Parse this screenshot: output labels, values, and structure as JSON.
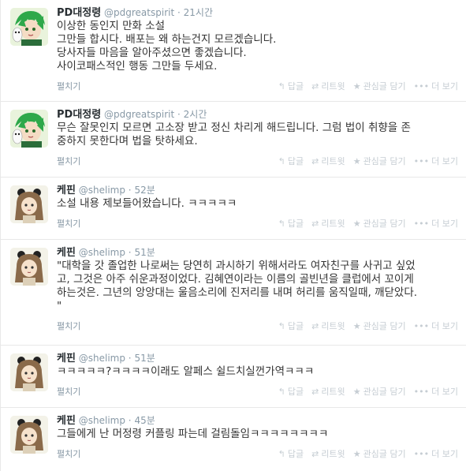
{
  "actions": {
    "reply": "답글",
    "retweet": "리트윗",
    "favorite": "관심글 담기",
    "more": "더 보기"
  },
  "expand_label": "펼치기",
  "icons": {
    "reply": "reply-icon",
    "retweet": "retweet-icon",
    "favorite": "star-icon",
    "more": "ellipsis-icon"
  },
  "tweets": [
    {
      "name": "PD대정령",
      "handle": "@pdgreatspirit",
      "dot": "·",
      "time": "21시간",
      "lines": [
        "이상한 동인지 만화 소설",
        "그만들 합시다. 배포는 왜 하는건지 모르겠습니다.",
        "당사자들 마음을 알아주셨으면 좋겠습니다.",
        "사이코패스적인 행동 그만들 두세요."
      ]
    },
    {
      "name": "PD대정령",
      "handle": "@pdgreatspirit",
      "dot": "·",
      "time": "2시간",
      "lines": [
        "무슨 잘못인지 모르면 고소장 받고 정신 차리게 해드립니다. 그럼 법이 취향을 존",
        "중하지 못한다며 법을 탓하세요."
      ]
    },
    {
      "name": "케핀",
      "handle": "@shelimp",
      "dot": "·",
      "time": "52분",
      "lines": [
        "소설 내용 제보들어왔습니다. ㅋㅋㅋㅋㅋ"
      ]
    },
    {
      "name": "케핀",
      "handle": "@shelimp",
      "dot": "·",
      "time": "51분",
      "lines": [
        "\"대학을 갓 졸업한 나로써는 당연히 과시하기 위해서라도 여자친구를 사귀고 싶었",
        "고, 그것은 아주 쉬운과정이었다. 김혜연이라는 이름의 골빈년을 클럽에서 꼬이게",
        "하는것은. 그년의 앙앙대는 울음소리에 진저리를 내며 허리를 움직일때, 깨닫았다.",
        "\""
      ]
    },
    {
      "name": "케핀",
      "handle": "@shelimp",
      "dot": "·",
      "time": "51분",
      "lines": [
        "ㅋㅋㅋㅋㅋ?ㅋㅋㅋㅋ이래도 알페스 쉴드치실껀가역ㅋㅋㅋ"
      ]
    },
    {
      "name": "케핀",
      "handle": "@shelimp",
      "dot": "·",
      "time": "45분",
      "lines": [
        "그들에게 난 머정령 커플링 파는데 걸림돌임ㅋㅋㅋㅋㅋㅋㅋㅋ"
      ]
    }
  ]
}
